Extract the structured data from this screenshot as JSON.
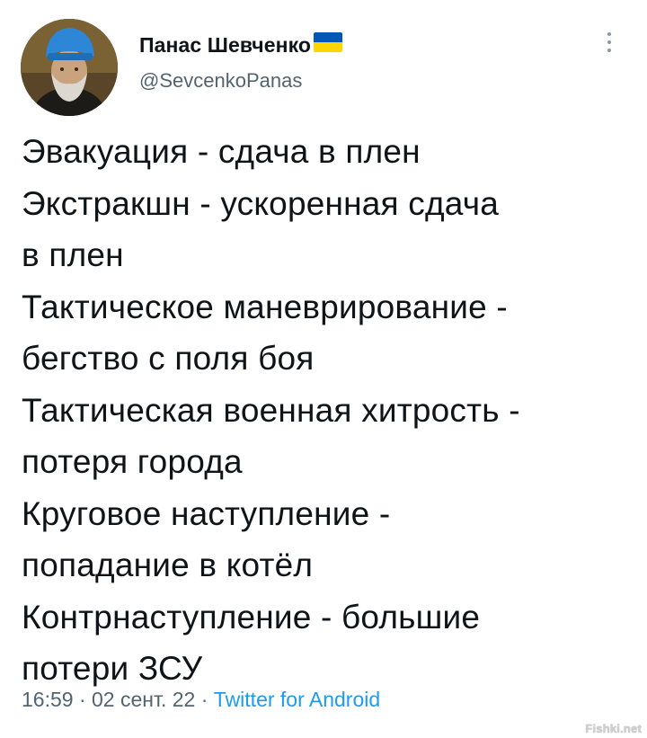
{
  "tweet": {
    "author_name": "Панас Шевченко",
    "handle": "@SevcenkoPanas",
    "flag_icon": "ukraine-flag-icon",
    "lines": [
      "Эвакуация - сдача в плен",
      "Экстракшн - ускоренная сдача",
      "в плен",
      "Тактическое маневрирование -",
      "бегство с поля боя",
      "Тактическая военная хитрость -",
      "потеря города",
      "Круговое наступление -",
      "попадание в котёл",
      "Контрнаступление - большие",
      "потери ЗСУ"
    ],
    "time": "16:59",
    "date": "02 сент. 22",
    "source": "Twitter for Android",
    "separator": "·"
  },
  "watermark": "Fishki.net",
  "colors": {
    "text": "#0f1419",
    "muted": "#536471",
    "link": "#1d9bf0",
    "flag_blue": "#0057b7",
    "flag_yellow": "#ffd500"
  }
}
